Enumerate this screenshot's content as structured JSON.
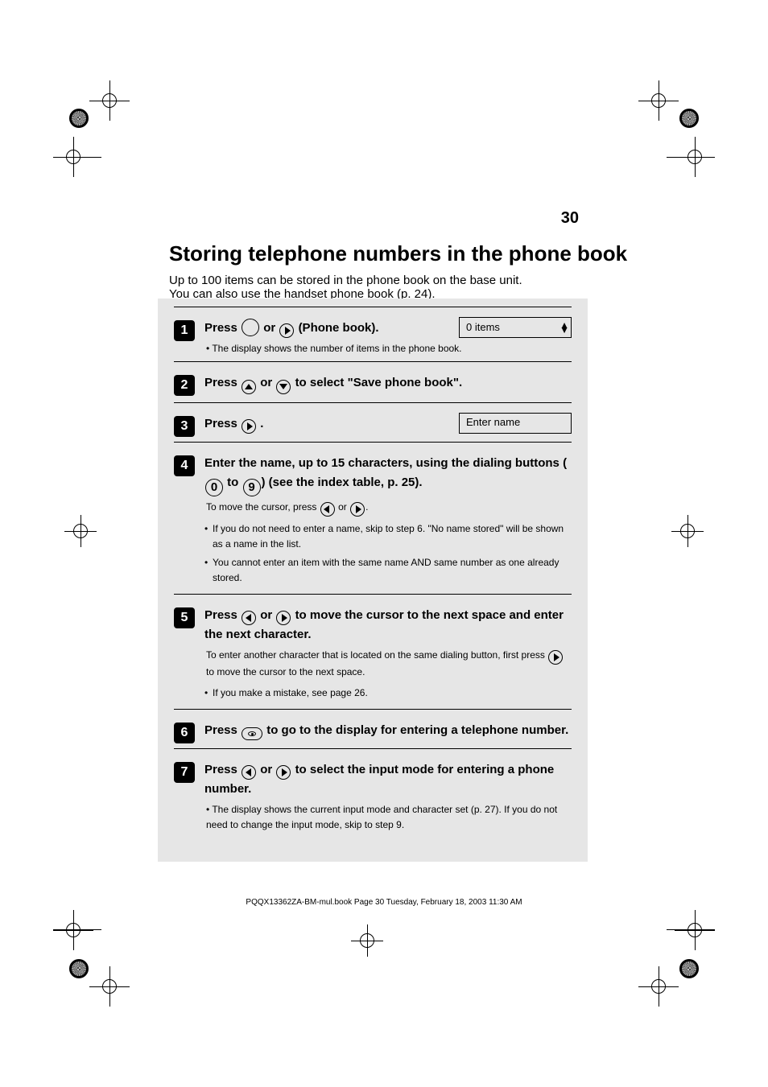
{
  "page_number": "30",
  "main_title": "Storing telephone numbers in the phone book",
  "subtitle_a": "Up to 100 items can be stored in the phone book on the base unit.",
  "subtitle_b": "You can also use the handset phone book (p. 24).",
  "steps": [
    {
      "n": 1,
      "icon": "right",
      "head_pre": "Press",
      "head_mid": " or ",
      "head_mid_icon": "right",
      "head_post": " (Phone book).",
      "lcd": "0 items",
      "note": "The display shows the number of items in the phone book."
    },
    {
      "n": 2,
      "icon": "up",
      "head_pre": "Press ",
      "head_mid": " or ",
      "head_mid_icon": "down",
      "head_post": " to select \"Save phone book\".",
      "note": ""
    },
    {
      "n": 3,
      "icon": "right",
      "head_pre": "Press ",
      "head_post": ".",
      "lcd": "Enter name",
      "note": ""
    },
    {
      "n": 4,
      "head_pre": "Enter the name, up to 15 characters, using the dialing buttons (0 to 9) (see the index table, p. 25).",
      "note": "To move the cursor, press",
      "note_icon_l": true,
      "note_icon_r": true,
      "bullets": [
        "If you do not need to enter a name, skip to step 6. \"No name stored\" will be shown as a name in the list.",
        "You cannot enter an item with the same name AND same number as one already stored."
      ]
    },
    {
      "n": 5,
      "head_pre": "Press ",
      "icons": [
        "left",
        "right"
      ],
      "head_post": " to move the cursor to the next space and enter the next character.",
      "note": "To enter another character that is located on the same dialing button, first press",
      "note_icon_r": true,
      "note_tail": " to move the cursor to the next space.",
      "bullets": [
        "If you make a mistake, see page 26."
      ]
    },
    {
      "n": 6,
      "oval": true,
      "head_pre": "Press ",
      "head_post": " to go to the display for entering a telephone number.",
      "note": ""
    },
    {
      "n": 7,
      "head_pre": "Press ",
      "icons": [
        "left",
        "right"
      ],
      "head_post": " to select the input mode for entering a phone number.",
      "note": "The display shows the current input mode and character set (p. 27). If you do not need to change the input mode, skip to step 9."
    }
  ],
  "footer": "PQQX13362ZA-BM-mul.book  Page 30  Tuesday, February 18, 2003  11:30 AM"
}
